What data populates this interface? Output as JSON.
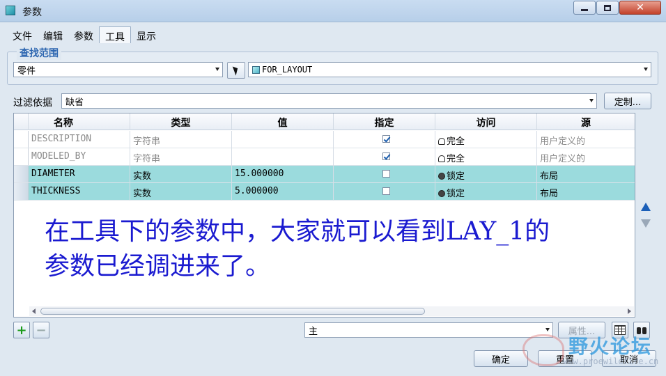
{
  "window": {
    "title": "参数"
  },
  "menu": {
    "items": [
      "文件",
      "编辑",
      "参数",
      "工具",
      "显示"
    ],
    "active_index": 3
  },
  "scope": {
    "group_title": "查找范围",
    "type_value": "零件",
    "object_value": "FOR_LAYOUT"
  },
  "filter": {
    "label": "过滤依据",
    "value": "缺省",
    "customize_label": "定制..."
  },
  "table": {
    "headers": [
      "名称",
      "类型",
      "值",
      "指定",
      "访问",
      "源"
    ],
    "rows": [
      {
        "name": "DESCRIPTION",
        "type": "字符串",
        "value": "",
        "designated": true,
        "access": "完全",
        "source": "用户定义的",
        "highlight": false
      },
      {
        "name": "MODELED_BY",
        "type": "字符串",
        "value": "",
        "designated": true,
        "access": "完全",
        "source": "用户定义的",
        "highlight": false
      },
      {
        "name": "DIAMETER",
        "type": "实数",
        "value": "15.000000",
        "designated": false,
        "access": "锁定",
        "source": "布局",
        "highlight": true
      },
      {
        "name": "THICKNESS",
        "type": "实数",
        "value": "5.000000",
        "designated": false,
        "access": "锁定",
        "source": "布局",
        "highlight": true
      }
    ]
  },
  "annotation": {
    "line1": "在工具下的参数中，大家就可以看到LAY_1的",
    "line2": "参数已经调进来了。"
  },
  "bottom": {
    "main_select": "主",
    "properties_label": "属性...",
    "ok_label": "确定",
    "reset_label": "重置",
    "cancel_label": "取消"
  },
  "watermark": {
    "text": "野火论坛",
    "url": "www.proewildfire.cn"
  }
}
